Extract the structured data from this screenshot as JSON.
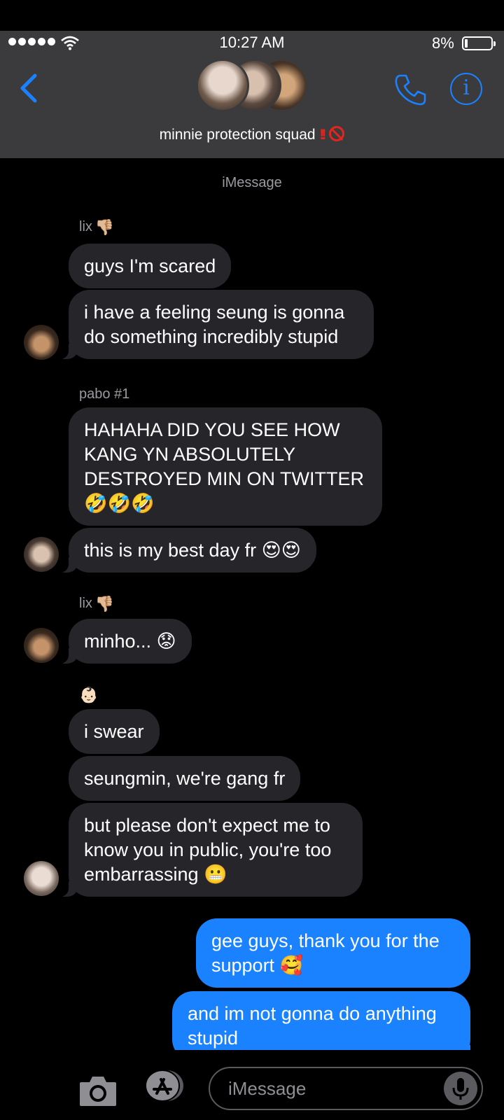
{
  "status_bar": {
    "time": "10:27 AM",
    "battery_percent": "8%",
    "signal_bars": 5,
    "icons": [
      "signal-dots-icon",
      "wifi-icon",
      "battery-icon"
    ]
  },
  "header": {
    "group_name": "minnie protection squad",
    "group_emoji": [
      "double-exclamation",
      "no-entry-icon"
    ],
    "icons": [
      "back-chevron-icon",
      "phone-icon",
      "info-icon"
    ]
  },
  "service_label": "iMessage",
  "messages": {
    "g1_sender": "lix",
    "g1_sender_emoji": "👎🏼",
    "g1_m1": "guys I'm scared",
    "g1_m2": "i have a feeling seung is gonna do something incredibly stupid",
    "g2_sender": "pabo #1",
    "g2_m1": "HAHAHA DID YOU SEE HOW KANG YN ABSOLUTELY DESTROYED MIN ON TWITTER 🤣🤣🤣",
    "g2_m2": "this is my best day fr 😍😍",
    "g3_sender": "lix",
    "g3_sender_emoji": "👎🏼",
    "g3_m1": "minho... 😟",
    "g4_sender_emoji": "👶🏻",
    "g4_m1": "i swear",
    "g4_m2": "seungmin, we're gang fr",
    "g4_m3": "but please don't expect me to know you in public, you're too embarrassing 😬",
    "out_m1": "gee guys, thank you for the support 🥰",
    "out_m2": "and im not gonna do anything stupid"
  },
  "input": {
    "placeholder": "iMessage"
  },
  "colors": {
    "header_bg": "#3b3b3d",
    "incoming_bubble": "#26252a",
    "outgoing_bubble": "#1a82ff",
    "accent": "#1a82ff"
  }
}
